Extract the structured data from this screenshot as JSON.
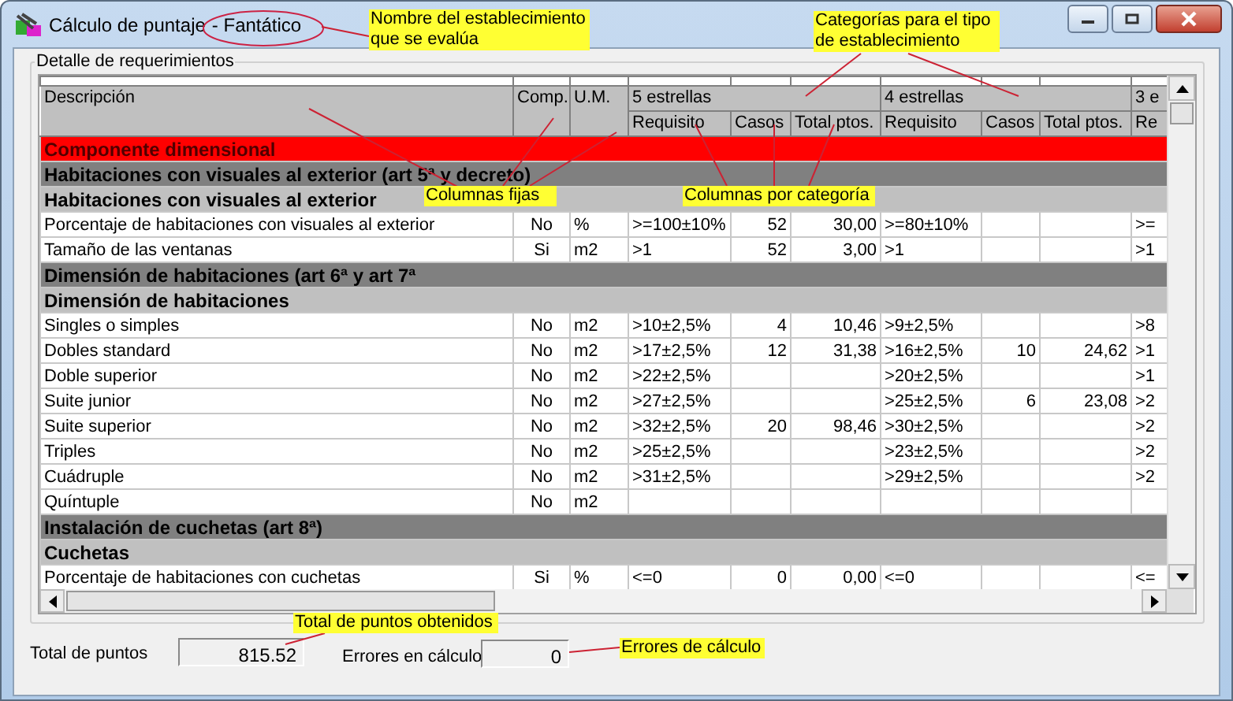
{
  "window": {
    "title": "Cálculo de puntaje",
    "establishment": "- Fantático"
  },
  "group_box": {
    "title": "Detalle de requerimientos"
  },
  "table": {
    "fixed_columns": [
      "Descripción",
      "Comp.",
      "U.M."
    ],
    "categories": [
      {
        "name": "5 estrellas",
        "columns": [
          "Requisito",
          "Casos",
          "Total ptos."
        ]
      },
      {
        "name": "4 estrellas",
        "columns": [
          "Requisito",
          "Casos",
          "Total ptos."
        ]
      },
      {
        "name": "3 e",
        "columns": [
          "Re"
        ]
      }
    ],
    "rows": [
      {
        "kind": "section",
        "description": "Componente dimensional"
      },
      {
        "kind": "group",
        "description": "Habitaciones con visuales al exterior (art 5ª y decreto)"
      },
      {
        "kind": "subgroup",
        "description": "Habitaciones con visuales al exterior"
      },
      {
        "kind": "item",
        "description": "Porcentaje de habitaciones con visuales al exterior",
        "comp": "No",
        "um": "%",
        "cells": [
          ">=100±10%",
          "52",
          "30,00",
          ">=80±10%",
          null,
          null,
          ">="
        ]
      },
      {
        "kind": "item",
        "description": "Tamaño de las ventanas",
        "comp": "Si",
        "um": "m2",
        "cells": [
          ">1",
          "52",
          "3,00",
          ">1",
          null,
          null,
          ">1"
        ]
      },
      {
        "kind": "group",
        "description": "Dimensión de habitaciones (art 6ª y art 7ª"
      },
      {
        "kind": "subgroup",
        "description": "Dimensión de habitaciones"
      },
      {
        "kind": "item",
        "description": "Singles o simples",
        "comp": "No",
        "um": "m2",
        "cells": [
          ">10±2,5%",
          "4",
          "10,46",
          ">9±2,5%",
          null,
          null,
          ">8"
        ]
      },
      {
        "kind": "item",
        "description": "Dobles standard",
        "comp": "No",
        "um": "m2",
        "cells": [
          ">17±2,5%",
          "12",
          "31,38",
          ">16±2,5%",
          "10",
          "24,62",
          ">1"
        ]
      },
      {
        "kind": "item",
        "description": "Doble superior",
        "comp": "No",
        "um": "m2",
        "cells": [
          ">22±2,5%",
          null,
          null,
          ">20±2,5%",
          null,
          null,
          ">1"
        ]
      },
      {
        "kind": "item",
        "description": "Suite junior",
        "comp": "No",
        "um": "m2",
        "cells": [
          ">27±2,5%",
          null,
          null,
          ">25±2,5%",
          "6",
          "23,08",
          ">2"
        ]
      },
      {
        "kind": "item",
        "description": "Suite superior",
        "comp": "No",
        "um": "m2",
        "cells": [
          ">32±2,5%",
          "20",
          "98,46",
          ">30±2,5%",
          null,
          null,
          ">2"
        ]
      },
      {
        "kind": "item",
        "description": "Triples",
        "comp": "No",
        "um": "m2",
        "cells": [
          ">25±2,5%",
          null,
          null,
          ">23±2,5%",
          null,
          null,
          ">2"
        ]
      },
      {
        "kind": "item",
        "description": "Cuádruple",
        "comp": "No",
        "um": "m2",
        "cells": [
          ">31±2,5%",
          null,
          null,
          ">29±2,5%",
          null,
          null,
          ">2"
        ]
      },
      {
        "kind": "item",
        "description": "Quíntuple",
        "comp": "No",
        "um": "m2",
        "cells": [
          null,
          null,
          null,
          null,
          null,
          null,
          null
        ]
      },
      {
        "kind": "group",
        "description": "Instalación de cuchetas (art 8ª)"
      },
      {
        "kind": "subgroup",
        "description": "Cuchetas"
      },
      {
        "kind": "item",
        "description": "Porcentaje de habitaciones con cuchetas",
        "comp": "Si",
        "um": "%",
        "cells": [
          "<=0",
          "0",
          "0,00",
          "<=0",
          null,
          null,
          "<="
        ]
      }
    ]
  },
  "totals": [
    {
      "label": "Total de puntos",
      "value": "815.52"
    },
    {
      "label": "Errores en cálculo",
      "value": "0"
    }
  ],
  "annotations": [
    {
      "kind": "establishment",
      "text": "Nombre del establecimiento que se evalúa"
    },
    {
      "kind": "categories",
      "text": "Categorías para el tipo de establecimiento"
    },
    {
      "kind": "fixed",
      "text": "Columnas fijas"
    },
    {
      "kind": "percategory",
      "text": "Columnas por categoría"
    },
    {
      "kind": "total",
      "text": "Total de puntos obtenidos"
    },
    {
      "kind": "errors",
      "text": "Errores de cálculo"
    }
  ]
}
